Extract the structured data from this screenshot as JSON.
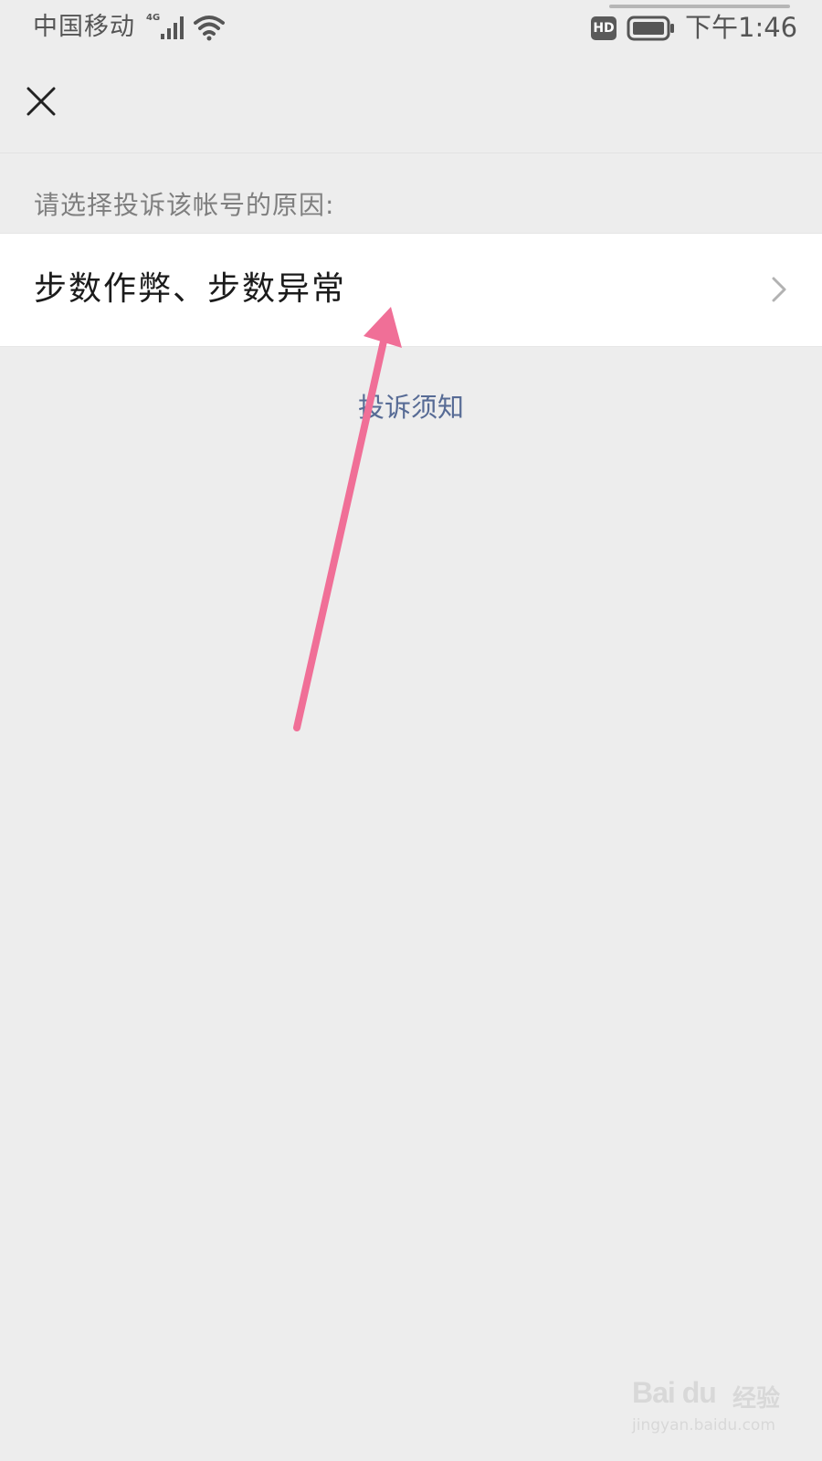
{
  "status_bar": {
    "carrier": "中国移动",
    "network_type": "4G",
    "hd_badge": "HD",
    "time": "下午1:46",
    "icons": [
      "signal-icon",
      "wifi-icon",
      "battery-icon"
    ]
  },
  "nav": {
    "close_icon": "close-icon"
  },
  "page": {
    "prompt": "请选择投诉该帐号的原因:",
    "reasons": [
      {
        "label": "步数作弊、步数异常",
        "icon": "chevron-right-icon"
      }
    ],
    "notice_link": "投诉须知"
  },
  "annotation": {
    "arrow_color": "#f06f97"
  },
  "watermark": {
    "brand": "Bai du",
    "product": "经验",
    "url": "jingyan.baidu.com"
  },
  "colors": {
    "background": "#ededed",
    "card": "#ffffff",
    "link": "#576b95",
    "text_secondary": "#7f7f7f"
  }
}
